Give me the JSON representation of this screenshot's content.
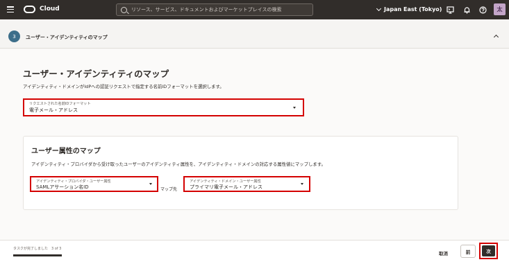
{
  "topbar": {
    "brand": "Cloud",
    "search_placeholder": "リソース、サービス、ドキュメントおよびマーケットプレイスの検索",
    "region": "Japan East (Tokyo)",
    "avatar_initial": "太"
  },
  "step": {
    "number": "3",
    "title": "ユーザー・アイデンティティのマップ"
  },
  "main": {
    "heading": "ユーザー・アイデンティティのマップ",
    "description": "アイデンティティ・ドメインがIdPへの認証リクエストで指定する名前IDフォーマットを選択します。",
    "nameid_select": {
      "label": "リクエストされた名前IDフォーマット",
      "value": "電子メール・アドレス"
    }
  },
  "mapping": {
    "heading": "ユーザー属性のマップ",
    "description": "アイデンティティ・プロバイダから受け取ったユーザーのアイデンティティ属性を、アイデンティティ・ドメインの対応する属性値にマップします。",
    "idp_select": {
      "label": "アイデンティティ・プロバイダ・ユーザー属性",
      "value": "SAMLアサーション名ID"
    },
    "map_to": "マップ先",
    "domain_select": {
      "label": "アイデンティティ・ドメイン・ユーザー属性",
      "value": "プライマリ電子メール・アドレス"
    }
  },
  "footer": {
    "progress_text": "タスクが完了しました　3 of 3",
    "progress_fraction": 1.0,
    "cancel_label": "取消",
    "prev_label": "前",
    "next_label": "次"
  },
  "colors": {
    "topbar": "#312d2a",
    "highlight": "#d40000",
    "step_badge": "#3c6e8a"
  }
}
